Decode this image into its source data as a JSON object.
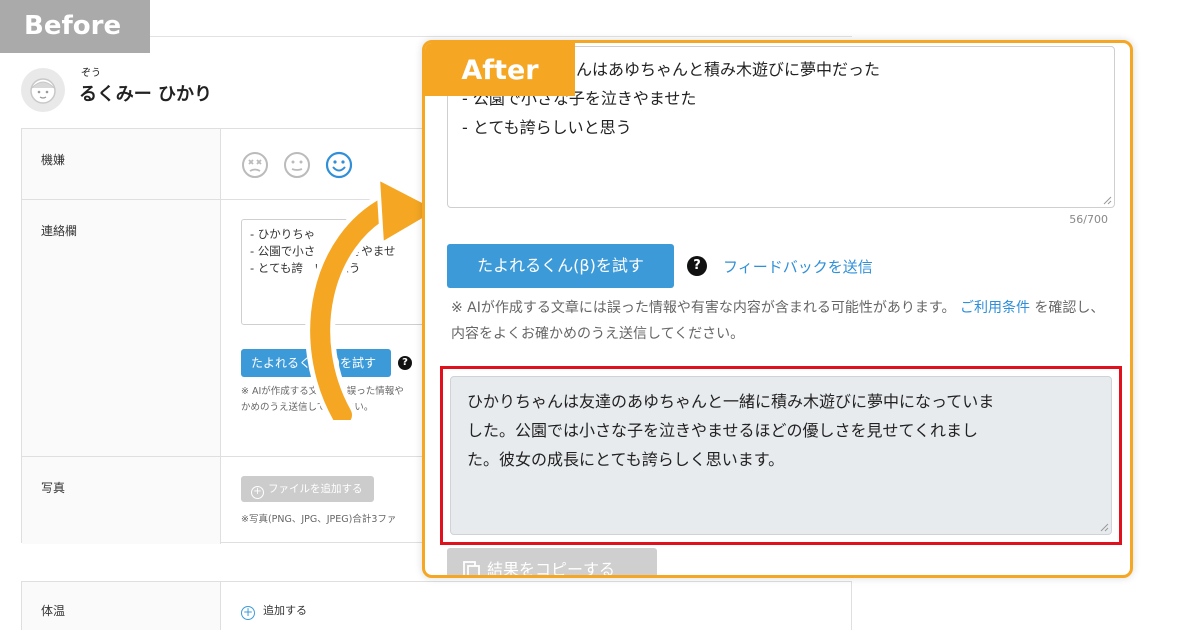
{
  "before": {
    "tag": "Before",
    "child": {
      "ruby": "ぞう",
      "name": "るくみー ひかり"
    },
    "rows": {
      "mood_label": "機嫌",
      "contact_label": "連絡欄",
      "photo_label": "写真",
      "temp_label": "体温"
    },
    "contact_lines": [
      "- ひかりちゃ",
      "- 公園で小さ　を泣きやませ",
      "- とても誇　いと思う"
    ],
    "try_button": "たよれるくん(β)を試す",
    "help": "?",
    "note_lines": [
      "※ AIが作成する文章には誤った情報や",
      "かめのうえ送信してください。"
    ],
    "add_file": "ファイルを追加する",
    "file_note": "※写真(PNG、JPG、JPEG)合計3ファ",
    "add_temp": "追加する"
  },
  "after": {
    "tag": "After",
    "input_lines": [
      "んはあゆちゃんと積み木遊びに夢中だった",
      "- 公園で小さな子を泣きやませた",
      "- とても誇らしいと思う"
    ],
    "char_count": "56/700",
    "try_button": "たよれるくん(β)を試す",
    "help": "?",
    "feedback_link": "フィードバックを送信",
    "disclaimer": {
      "before_link": "※ AIが作成する文章には誤った情報や有害な内容が含まれる可能性があります。",
      "link": "ご利用条件",
      "after_link": "を確認し、内容をよくお確かめのうえ送信してください。"
    },
    "result_lines": [
      "ひかりちゃんは友達のあゆちゃんと一緒に積み木遊びに夢中になっていま",
      "した。公園では小さな子を泣きやませるほどの優しさを見せてくれまし",
      "た。彼女の成長にとても誇らしく思います。"
    ],
    "copy_button": "結果をコピーする"
  },
  "colors": {
    "accent_blue": "#3d9ad9",
    "after_orange": "#f5a623",
    "highlight_red": "#e0101d",
    "before_gray": "#aaaaaa"
  },
  "icons": [
    "face-dizzy-icon",
    "face-neutral-icon",
    "face-smile-icon",
    "question-icon",
    "plus-circle-icon",
    "copy-icon",
    "curved-arrow-icon"
  ]
}
